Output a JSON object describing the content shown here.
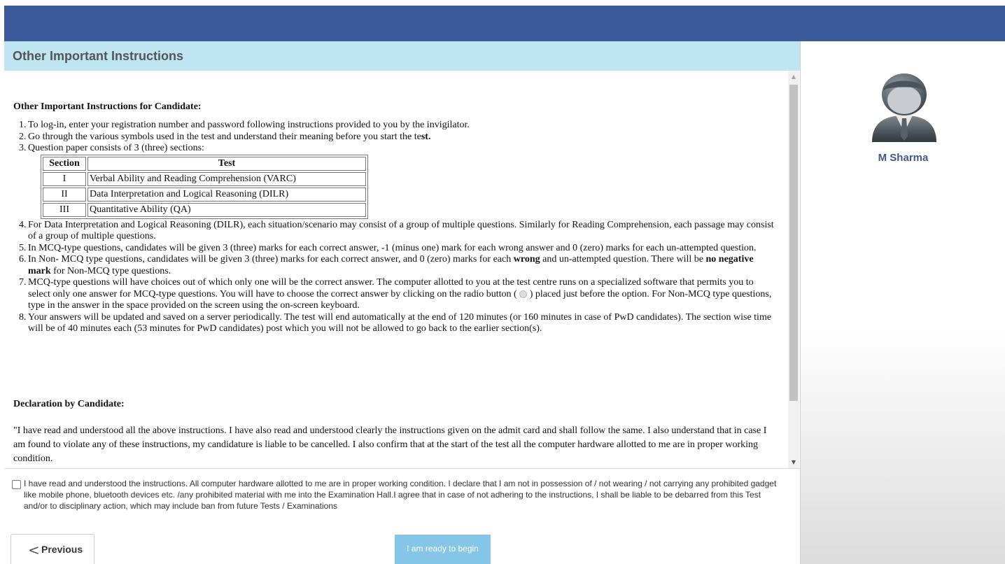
{
  "header": {
    "title": "Other Important Instructions"
  },
  "content": {
    "heading": "Other Important Instructions for Candidate:",
    "items": [
      {
        "num": "1.",
        "text": "To log-in, enter your registration number and password following instructions provided to you by the invigilator."
      },
      {
        "num": "2.",
        "text_a": "Go through the various symbols used in the test and understand their meaning before you start the te",
        "text_b": "st."
      },
      {
        "num": "3.",
        "text": "Question paper consists of 3 (three) sections:"
      },
      {
        "num": "4.",
        "text": "For Data Interpretation and Logical Reasoning (DILR), each situation/scenario may consist of a group of multiple questions. Similarly for Reading Comprehension, each passage may consist of a group of multiple questions."
      },
      {
        "num": "5.",
        "text": "In MCQ-type questions, candidates will be given 3 (three) marks for each correct answer, -1 (minus one) mark for each wrong answer and 0 (zero) marks for each un-attempted question."
      },
      {
        "num": "6.",
        "text_a": "In Non- MCQ type questions, candidates will be given 3 (three) marks for each correct answer, and 0 (zero) marks for each ",
        "bold_a": "wrong",
        "text_b": " and un-attempted question. There will be ",
        "bold_b": "no negative mark",
        "text_c": " for Non-MCQ type questions."
      },
      {
        "num": "7.",
        "text_a": "MCQ-type questions will have choices out of which only one will be the correct answer. The computer allotted to you at the test centre runs on a specialized software that permits you to select only one answer for MCQ-type questions. You will have to choose the correct answer by clicking on the radio button (",
        "text_b": ") placed just before the option. For Non-MCQ type questions, type in the answer in the space provided on the screen using the on-screen keyboard."
      },
      {
        "num": "8.",
        "text": "Your answers will be updated and saved on a server periodically. The test will end automatically at the end of 120 minutes (or 160 minutes in case of PwD candidates). The section wise time will be of 40 minutes each (53 minutes for PwD candidates) post which you will not be allowed to go back to the earlier section(s)."
      }
    ],
    "table": {
      "headers": [
        "Section",
        "Test"
      ],
      "rows": [
        [
          "I",
          "Verbal Ability and Reading Comprehension (VARC)"
        ],
        [
          "II",
          "Data Interpretation and Logical Reasoning (DILR)"
        ],
        [
          "III",
          "Quantitative Ability (QA)"
        ]
      ]
    },
    "declaration_heading": "Declaration by Candidate:",
    "declaration_text": "\"I have read and understood all the above instructions. I have also read and understood clearly the instructions given on the admit card and shall follow the same. I also understand that in case I am found to violate any of these instructions, my candidature is liable to be cancelled. I also confirm that at the start of the test all the computer hardware allotted to me are in proper working condition."
  },
  "agreement": {
    "checked": false,
    "text": "I have read and understood the instructions. All computer hardware allotted to me are in proper working condition. I declare that I am not in possession of / not wearing / not carrying any prohibited gadget like mobile phone, bluetooth devices etc. /any prohibited material with me into the Examination Hall.I agree that in case of not adhering to the instructions, I shall be liable to be debarred from this Test and/or to disciplinary action, which may include ban from future Tests / Examinations"
  },
  "buttons": {
    "previous_label": "Previous",
    "begin_label": "I am ready to begin"
  },
  "sidebar": {
    "user_name": "M Sharma",
    "avatar_icon": "user-avatar-icon"
  },
  "colors": {
    "topbar": "#3b5998",
    "heading_bg": "#bfe5f2",
    "begin_button": "#84c5e8",
    "user_name": "#3c5a8a"
  }
}
